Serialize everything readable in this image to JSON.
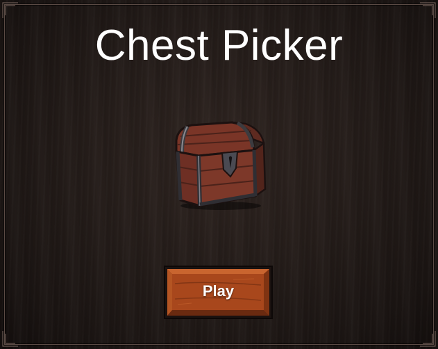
{
  "game": {
    "title": "Chest Picker",
    "play_label": "Play"
  },
  "theme": {
    "background": "#1a1412",
    "frame": "#5a4a44",
    "button_wood": "#a8471c",
    "chest_wood": "#7a3527"
  },
  "icons": {
    "chest": "treasure-chest-icon"
  }
}
